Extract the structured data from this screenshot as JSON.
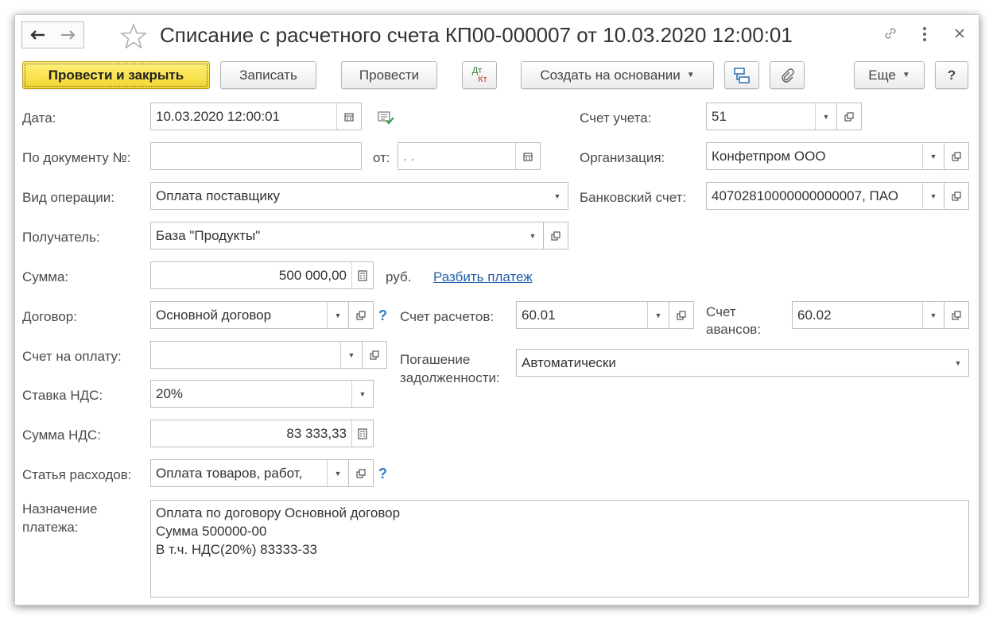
{
  "window": {
    "title": "Списание с расчетного счета КП00-000007 от 10.03.2020 12:00:01"
  },
  "toolbar": {
    "post_close": "Провести и закрыть",
    "save": "Записать",
    "post": "Провести",
    "dtkt_top": "Дт",
    "dtkt_bottom": "Кт",
    "create_based": "Создать на основании",
    "more": "Еще",
    "help": "?"
  },
  "form": {
    "date": {
      "label": "Дата:",
      "value": "10.03.2020 12:00:01"
    },
    "doc_number": {
      "label": "По документу №:",
      "value": "",
      "from_label": "от:",
      "from_value": " .  ."
    },
    "operation_type": {
      "label": "Вид операции:",
      "value": "Оплата поставщику"
    },
    "recipient": {
      "label": "Получатель:",
      "value": "База \"Продукты\""
    },
    "amount": {
      "label": "Сумма:",
      "value": "500 000,00",
      "currency": "руб.",
      "split_link": "Разбить платеж"
    },
    "contract": {
      "label": "Договор:",
      "value": "Основной договор",
      "help": "?"
    },
    "invoice": {
      "label": "Счет на оплату:",
      "value": ""
    },
    "vat_rate": {
      "label": "Ставка НДС:",
      "value": "20%"
    },
    "vat_amount": {
      "label": "Сумма НДС:",
      "value": "83 333,33"
    },
    "expense_item": {
      "label": "Статья расходов:",
      "value": "Оплата товаров, работ,",
      "help": "?"
    },
    "purpose": {
      "label_line1": "Назначение",
      "label_line2": "платежа:",
      "lines": [
        "Оплата по договору Основной договор",
        "Сумма 500000-00",
        "В т.ч. НДС(20%) 83333-33"
      ]
    },
    "account": {
      "label": "Счет учета:",
      "value": "51"
    },
    "organization": {
      "label": "Организация:",
      "value": "Конфетпром ООО"
    },
    "bank_account": {
      "label": "Банковский счет:",
      "value": "40702810000000000007, ПАО"
    },
    "settlement_account": {
      "label": "Счет расчетов:",
      "value": "60.01"
    },
    "advance_account": {
      "label_line1": "Счет",
      "label_line2": "авансов:",
      "value": "60.02"
    },
    "debt_repayment": {
      "label_line1": "Погашение",
      "label_line2": "задолженности:",
      "value": "Автоматически"
    }
  }
}
